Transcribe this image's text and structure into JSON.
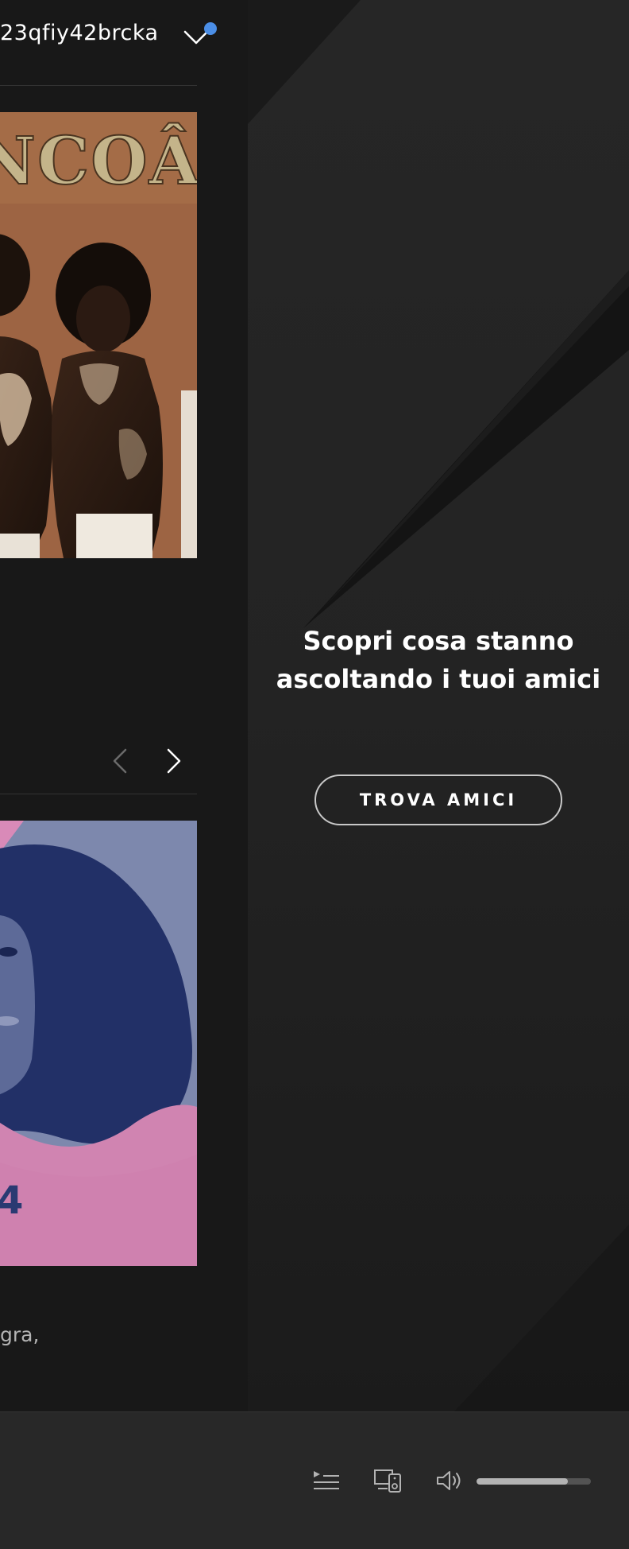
{
  "header": {
    "username": "23qfiy42brcka",
    "notification_dot_color": "#4b8ee6"
  },
  "main": {
    "cards": [
      {
        "art_text": "NCOÂS",
        "description": ""
      },
      {
        "art_text": "4",
        "description": "gra,"
      }
    ],
    "carousel": {
      "prev_icon": "chevron-left-icon",
      "next_icon": "chevron-right-icon"
    }
  },
  "friend_activity": {
    "headline_line1": "Scopri cosa stanno",
    "headline_line2": "ascoltando i tuoi amici",
    "button_label": "TROVA AMICI"
  },
  "player": {
    "icons": [
      "queue-icon",
      "devices-icon",
      "volume-icon"
    ],
    "volume_level": 0.8
  },
  "colors": {
    "background": "#121212",
    "panel": "#181818",
    "friends_panel": "#262626",
    "player_bar": "#282828",
    "accent_blue": "#4b8ee6"
  }
}
